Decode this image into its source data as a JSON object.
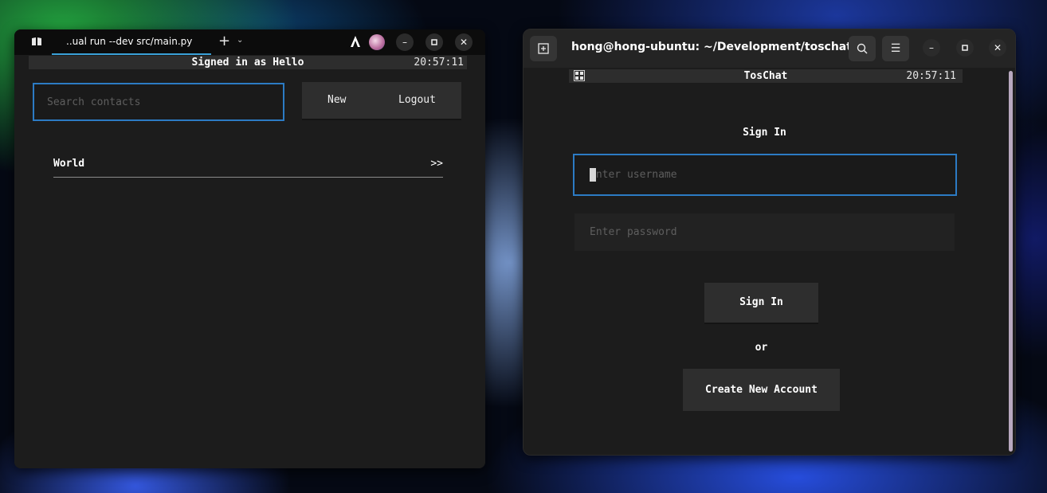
{
  "left_window": {
    "tab_title": "..ual run --dev src/main.py",
    "icons": {
      "app": "book-icon",
      "new_tab": "plus-icon",
      "tab_dropdown": "chevron-down-icon",
      "profile": "a-logo-icon",
      "avatar": "avatar",
      "minimize": "minimize-icon",
      "maximize": "maximize-icon",
      "close": "close-icon"
    },
    "header": {
      "title": "Signed in as Hello",
      "clock": "20:57:11"
    },
    "search": {
      "placeholder": "Search contacts",
      "value": ""
    },
    "buttons": {
      "new_label": "New",
      "logout_label": "Logout"
    },
    "contacts": [
      {
        "name": "World",
        "arrow": ">>"
      }
    ]
  },
  "right_window": {
    "title": "hong@hong-ubuntu: ~/Development/toschat",
    "icons": {
      "new_tab": "new-tab-icon",
      "search": "search-icon",
      "menu": "hamburger-menu-icon",
      "minimize": "minimize-icon",
      "maximize": "maximize-icon",
      "close": "close-icon"
    },
    "header": {
      "app_name": "TosChat",
      "clock": "20:57:11"
    },
    "form": {
      "heading": "Sign In",
      "username_placeholder": "Enter username",
      "username_value": "",
      "password_placeholder": "Enter password",
      "password_value": "",
      "signin_label": "Sign In",
      "or_text": "or",
      "create_label": "Create New Account"
    }
  },
  "colors": {
    "focus_border": "#2c7bc4",
    "tab_underline": "#3aa0d8",
    "panel_bg": "#1c1c1c",
    "header_bg": "#2d2d2d",
    "button_bg": "#2e2e2e"
  }
}
